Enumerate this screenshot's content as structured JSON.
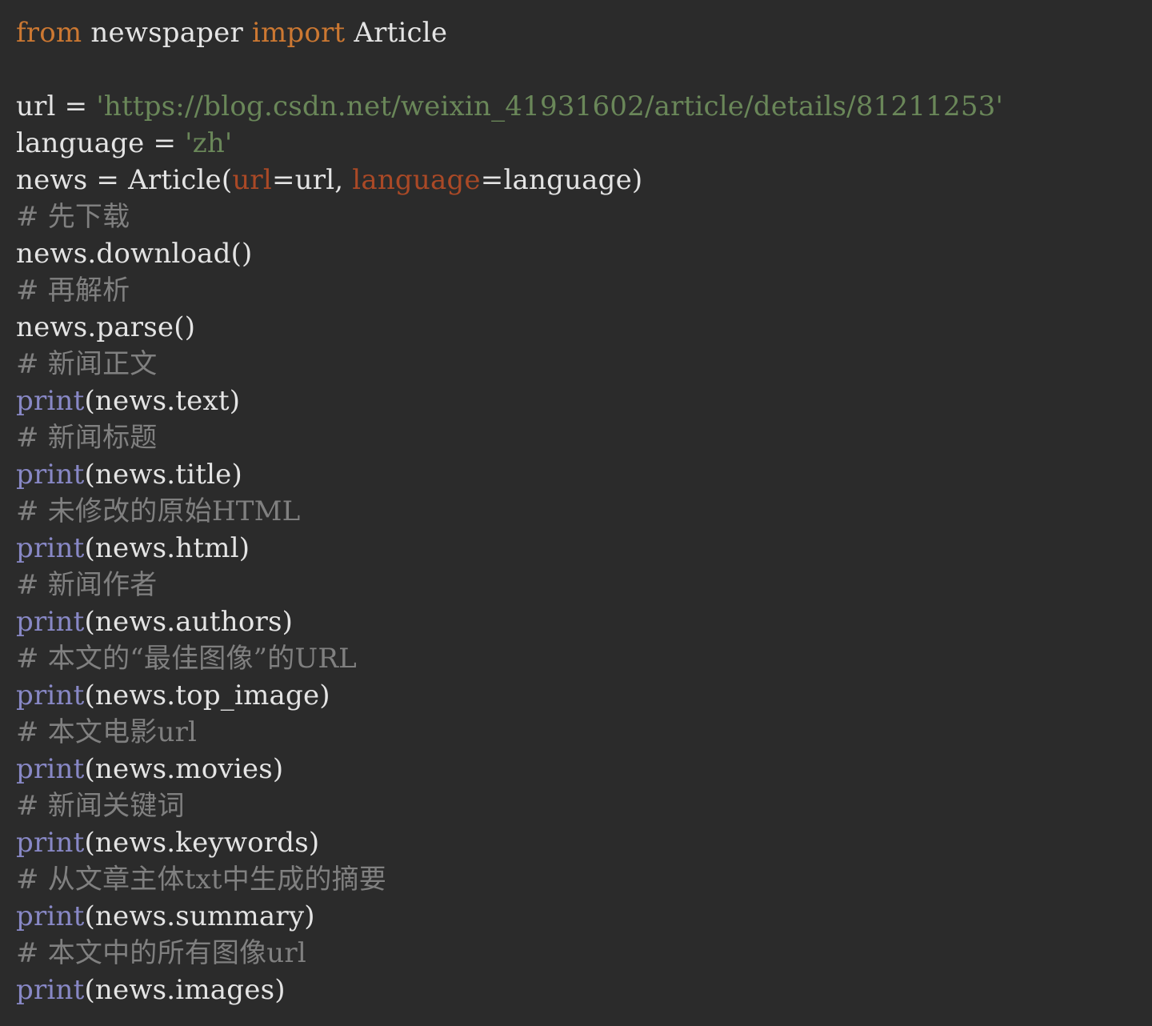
{
  "editor": {
    "background": "#2b2b2b",
    "colors": {
      "keyword": "#cc7832",
      "string": "#6a8759",
      "parameter": "#aa4926",
      "builtin": "#8888c6",
      "comment": "#808080",
      "text": "#e4e4e4"
    },
    "lines": [
      [
        {
          "t": "kw",
          "v": "from"
        },
        {
          "t": "plain",
          "v": " newspaper "
        },
        {
          "t": "kw",
          "v": "import"
        },
        {
          "t": "plain",
          "v": " Article"
        }
      ],
      [],
      [
        {
          "t": "plain",
          "v": "url = "
        },
        {
          "t": "str",
          "v": "'https://blog.csdn.net/weixin_41931602/article/details/81211253'"
        }
      ],
      [
        {
          "t": "plain",
          "v": "language = "
        },
        {
          "t": "str",
          "v": "'zh'"
        }
      ],
      [
        {
          "t": "plain",
          "v": "news = Article("
        },
        {
          "t": "param",
          "v": "url"
        },
        {
          "t": "plain",
          "v": "=url, "
        },
        {
          "t": "param",
          "v": "language"
        },
        {
          "t": "plain",
          "v": "=language)"
        }
      ],
      [
        {
          "t": "comment",
          "v": "# 先下载"
        }
      ],
      [
        {
          "t": "plain",
          "v": "news.download()"
        }
      ],
      [
        {
          "t": "comment",
          "v": "# 再解析"
        }
      ],
      [
        {
          "t": "plain",
          "v": "news.parse()"
        }
      ],
      [
        {
          "t": "comment",
          "v": "# 新闻正文"
        }
      ],
      [
        {
          "t": "builtin",
          "v": "print"
        },
        {
          "t": "plain",
          "v": "(news.text)"
        }
      ],
      [
        {
          "t": "comment",
          "v": "# 新闻标题"
        }
      ],
      [
        {
          "t": "builtin",
          "v": "print"
        },
        {
          "t": "plain",
          "v": "(news.title)"
        }
      ],
      [
        {
          "t": "comment",
          "v": "# 未修改的原始HTML"
        }
      ],
      [
        {
          "t": "builtin",
          "v": "print"
        },
        {
          "t": "plain",
          "v": "(news.html)"
        }
      ],
      [
        {
          "t": "comment",
          "v": "# 新闻作者"
        }
      ],
      [
        {
          "t": "builtin",
          "v": "print"
        },
        {
          "t": "plain",
          "v": "(news.authors)"
        }
      ],
      [
        {
          "t": "comment",
          "v": "# 本文的“最佳图像”的URL"
        }
      ],
      [
        {
          "t": "builtin",
          "v": "print"
        },
        {
          "t": "plain",
          "v": "(news.top_image)"
        }
      ],
      [
        {
          "t": "comment",
          "v": "# 本文电影url"
        }
      ],
      [
        {
          "t": "builtin",
          "v": "print"
        },
        {
          "t": "plain",
          "v": "(news.movies)"
        }
      ],
      [
        {
          "t": "comment",
          "v": "# 新闻关键词"
        }
      ],
      [
        {
          "t": "builtin",
          "v": "print"
        },
        {
          "t": "plain",
          "v": "(news.keywords)"
        }
      ],
      [
        {
          "t": "comment",
          "v": "# 从文章主体txt中生成的摘要"
        }
      ],
      [
        {
          "t": "builtin",
          "v": "print"
        },
        {
          "t": "plain",
          "v": "(news.summary)"
        }
      ],
      [
        {
          "t": "comment",
          "v": "# 本文中的所有图像url"
        }
      ],
      [
        {
          "t": "builtin",
          "v": "print"
        },
        {
          "t": "plain",
          "v": "(news.images)"
        }
      ]
    ]
  }
}
